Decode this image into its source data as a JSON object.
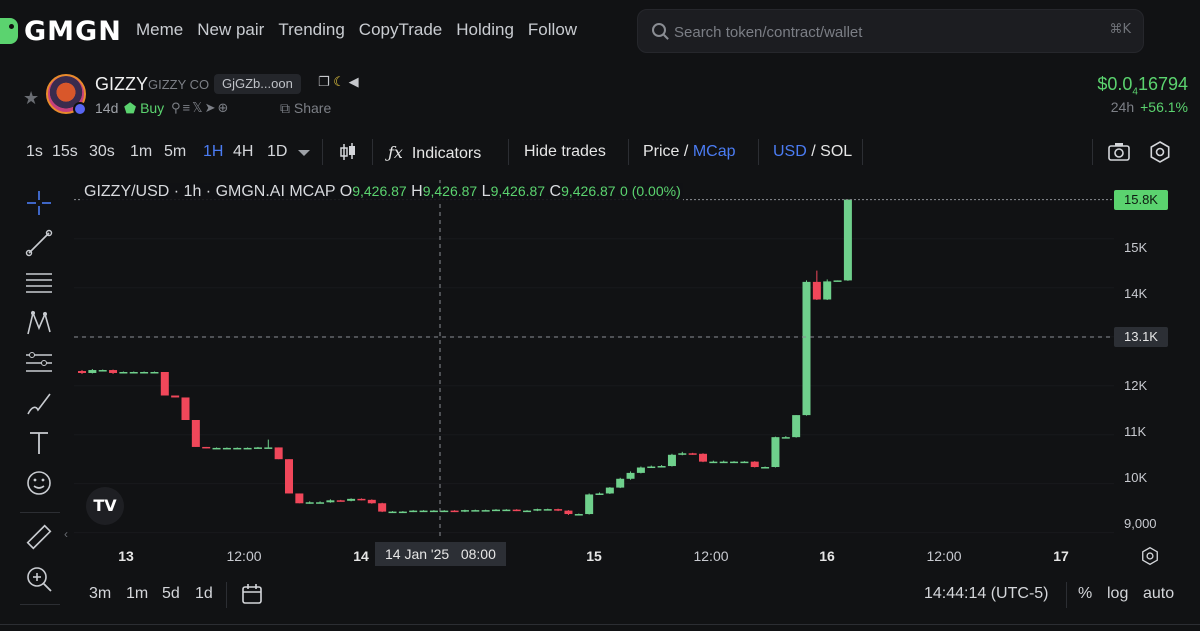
{
  "brand": {
    "name": "GMGN"
  },
  "nav": [
    "Meme",
    "New pair",
    "Trending",
    "CopyTrade",
    "Holding",
    "Follow"
  ],
  "search": {
    "placeholder": "Search token/contract/wallet",
    "shortcut": "⌘K"
  },
  "token": {
    "symbol": "GIZZY",
    "name": "GIZZY CO",
    "address": "GjGZb...oon",
    "age": "14d",
    "buy_label": "Buy",
    "share_label": "Share",
    "price_prefix": "$0.0",
    "price_sub": "4",
    "price_suffix": "16794",
    "change_label": "24h",
    "change_value": "+56.1%"
  },
  "toolbar": {
    "timeframes": [
      "1s",
      "15s",
      "30s",
      "1m",
      "5m",
      "1H",
      "4H",
      "1D"
    ],
    "active_timeframe": "1H",
    "indicators_label": "Indicators",
    "hide_trades_label": "Hide trades",
    "price_label": "Price",
    "mcap_label": "MCap",
    "usd_label": "USD",
    "sol_label": "SOL",
    "slash": "/"
  },
  "legend": {
    "pair": "GIZZY/USD · 1h · GMGN.AI MCAP",
    "o_label": "O",
    "o_value": "9,426.87",
    "h_label": "H",
    "h_value": "9,426.87",
    "l_label": "L",
    "l_value": "9,426.87",
    "c_label": "C",
    "c_value": "9,426.87",
    "change": "0 (0.00%)"
  },
  "tv_logo": "TV",
  "price_axis": {
    "ticks": [
      "15K",
      "14K",
      "12K",
      "11K",
      "10K",
      "9,000"
    ],
    "current_tag": "15.8K",
    "cross_tag": "13.1K",
    "current_color": "#5bd36f"
  },
  "time_axis": {
    "ticks": [
      {
        "label": "13",
        "day": true
      },
      {
        "label": "12:00",
        "day": false
      },
      {
        "label": "14",
        "day": true
      },
      {
        "label": "15",
        "day": true
      },
      {
        "label": "12:00",
        "day": false
      },
      {
        "label": "16",
        "day": true
      },
      {
        "label": "12:00",
        "day": false
      },
      {
        "label": "17",
        "day": true
      }
    ],
    "crosshair_label": "14 Jan '25   08:00"
  },
  "bottom": {
    "ranges": [
      "3m",
      "1m",
      "5d",
      "1d"
    ],
    "clock": "14:44:14 (UTC-5)",
    "percent_label": "%",
    "log_label": "log",
    "auto_label": "auto"
  },
  "colors": {
    "up": "#6fd08c",
    "down": "#f0475a",
    "accent": "#4b7cf3"
  },
  "chart_data": {
    "type": "candlestick",
    "unit": "USD market cap",
    "candles": [
      {
        "o": 12300,
        "h": 12320,
        "l": 12240,
        "c": 12260
      },
      {
        "o": 12260,
        "h": 12340,
        "l": 12250,
        "c": 12320
      },
      {
        "o": 12320,
        "h": 12330,
        "l": 12300,
        "c": 12320
      },
      {
        "o": 12320,
        "h": 12330,
        "l": 12240,
        "c": 12260
      },
      {
        "o": 12260,
        "h": 12290,
        "l": 12250,
        "c": 12280
      },
      {
        "o": 12280,
        "h": 12290,
        "l": 12270,
        "c": 12280
      },
      {
        "o": 12280,
        "h": 12290,
        "l": 12270,
        "c": 12280
      },
      {
        "o": 12280,
        "h": 12290,
        "l": 12270,
        "c": 12280
      },
      {
        "o": 12280,
        "h": 12280,
        "l": 11800,
        "c": 11800
      },
      {
        "o": 11800,
        "h": 11800,
        "l": 11760,
        "c": 11760
      },
      {
        "o": 11760,
        "h": 11760,
        "l": 11300,
        "c": 11300
      },
      {
        "o": 11300,
        "h": 11300,
        "l": 10750,
        "c": 10750
      },
      {
        "o": 10750,
        "h": 10750,
        "l": 10720,
        "c": 10730
      },
      {
        "o": 10730,
        "h": 10740,
        "l": 10720,
        "c": 10730
      },
      {
        "o": 10730,
        "h": 10740,
        "l": 10720,
        "c": 10730
      },
      {
        "o": 10730,
        "h": 10740,
        "l": 10720,
        "c": 10730
      },
      {
        "o": 10730,
        "h": 10740,
        "l": 10720,
        "c": 10730
      },
      {
        "o": 10730,
        "h": 10750,
        "l": 10720,
        "c": 10740
      },
      {
        "o": 10740,
        "h": 10900,
        "l": 10720,
        "c": 10740
      },
      {
        "o": 10740,
        "h": 10740,
        "l": 10500,
        "c": 10500
      },
      {
        "o": 10500,
        "h": 10500,
        "l": 9800,
        "c": 9800
      },
      {
        "o": 9800,
        "h": 9800,
        "l": 9600,
        "c": 9600
      },
      {
        "o": 9600,
        "h": 9640,
        "l": 9590,
        "c": 9620
      },
      {
        "o": 9620,
        "h": 9640,
        "l": 9600,
        "c": 9620
      },
      {
        "o": 9620,
        "h": 9680,
        "l": 9610,
        "c": 9660
      },
      {
        "o": 9660,
        "h": 9670,
        "l": 9640,
        "c": 9650
      },
      {
        "o": 9650,
        "h": 9700,
        "l": 9640,
        "c": 9690
      },
      {
        "o": 9690,
        "h": 9700,
        "l": 9660,
        "c": 9670
      },
      {
        "o": 9670,
        "h": 9680,
        "l": 9590,
        "c": 9600
      },
      {
        "o": 9600,
        "h": 9610,
        "l": 9420,
        "c": 9430
      },
      {
        "o": 9430,
        "h": 9440,
        "l": 9420,
        "c": 9430
      },
      {
        "o": 9430,
        "h": 9440,
        "l": 9420,
        "c": 9430
      },
      {
        "o": 9430,
        "h": 9460,
        "l": 9420,
        "c": 9450
      },
      {
        "o": 9450,
        "h": 9460,
        "l": 9440,
        "c": 9450
      },
      {
        "o": 9450,
        "h": 9460,
        "l": 9440,
        "c": 9450
      },
      {
        "o": 9450,
        "h": 9460,
        "l": 9440,
        "c": 9450
      },
      {
        "o": 9450,
        "h": 9460,
        "l": 9420,
        "c": 9430
      },
      {
        "o": 9430,
        "h": 9470,
        "l": 9420,
        "c": 9460
      },
      {
        "o": 9460,
        "h": 9470,
        "l": 9450,
        "c": 9460
      },
      {
        "o": 9460,
        "h": 9470,
        "l": 9450,
        "c": 9460
      },
      {
        "o": 9460,
        "h": 9480,
        "l": 9450,
        "c": 9470
      },
      {
        "o": 9470,
        "h": 9480,
        "l": 9460,
        "c": 9470
      },
      {
        "o": 9470,
        "h": 9480,
        "l": 9440,
        "c": 9450
      },
      {
        "o": 9450,
        "h": 9460,
        "l": 9440,
        "c": 9450
      },
      {
        "o": 9450,
        "h": 9490,
        "l": 9440,
        "c": 9480
      },
      {
        "o": 9480,
        "h": 9490,
        "l": 9470,
        "c": 9480
      },
      {
        "o": 9480,
        "h": 9490,
        "l": 9440,
        "c": 9450
      },
      {
        "o": 9450,
        "h": 9460,
        "l": 9360,
        "c": 9380
      },
      {
        "o": 9380,
        "h": 9390,
        "l": 9370,
        "c": 9380
      },
      {
        "o": 9380,
        "h": 9800,
        "l": 9370,
        "c": 9780
      },
      {
        "o": 9780,
        "h": 9820,
        "l": 9770,
        "c": 9800
      },
      {
        "o": 9800,
        "h": 9930,
        "l": 9790,
        "c": 9920
      },
      {
        "o": 9920,
        "h": 10120,
        "l": 9910,
        "c": 10100
      },
      {
        "o": 10100,
        "h": 10250,
        "l": 10080,
        "c": 10220
      },
      {
        "o": 10220,
        "h": 10350,
        "l": 10210,
        "c": 10330
      },
      {
        "o": 10330,
        "h": 10370,
        "l": 10320,
        "c": 10350
      },
      {
        "o": 10350,
        "h": 10380,
        "l": 10340,
        "c": 10360
      },
      {
        "o": 10360,
        "h": 10610,
        "l": 10350,
        "c": 10590
      },
      {
        "o": 10590,
        "h": 10650,
        "l": 10580,
        "c": 10620
      },
      {
        "o": 10620,
        "h": 10630,
        "l": 10590,
        "c": 10610
      },
      {
        "o": 10610,
        "h": 10620,
        "l": 10440,
        "c": 10450
      },
      {
        "o": 10450,
        "h": 10470,
        "l": 10440,
        "c": 10450
      },
      {
        "o": 10450,
        "h": 10470,
        "l": 10440,
        "c": 10450
      },
      {
        "o": 10450,
        "h": 10460,
        "l": 10440,
        "c": 10450
      },
      {
        "o": 10450,
        "h": 10460,
        "l": 10440,
        "c": 10450
      },
      {
        "o": 10450,
        "h": 10460,
        "l": 10330,
        "c": 10340
      },
      {
        "o": 10340,
        "h": 10350,
        "l": 10330,
        "c": 10340
      },
      {
        "o": 10340,
        "h": 10960,
        "l": 10330,
        "c": 10950
      },
      {
        "o": 10950,
        "h": 10970,
        "l": 10940,
        "c": 10950
      },
      {
        "o": 10950,
        "h": 11400,
        "l": 10940,
        "c": 11400
      },
      {
        "o": 11400,
        "h": 14150,
        "l": 11390,
        "c": 14120
      },
      {
        "o": 14120,
        "h": 14350,
        "l": 13750,
        "c": 13760
      },
      {
        "o": 13760,
        "h": 14170,
        "l": 13750,
        "c": 14130
      },
      {
        "o": 14130,
        "h": 14150,
        "l": 14130,
        "c": 14150
      },
      {
        "o": 14150,
        "h": 15800,
        "l": 14140,
        "c": 15800
      }
    ]
  }
}
